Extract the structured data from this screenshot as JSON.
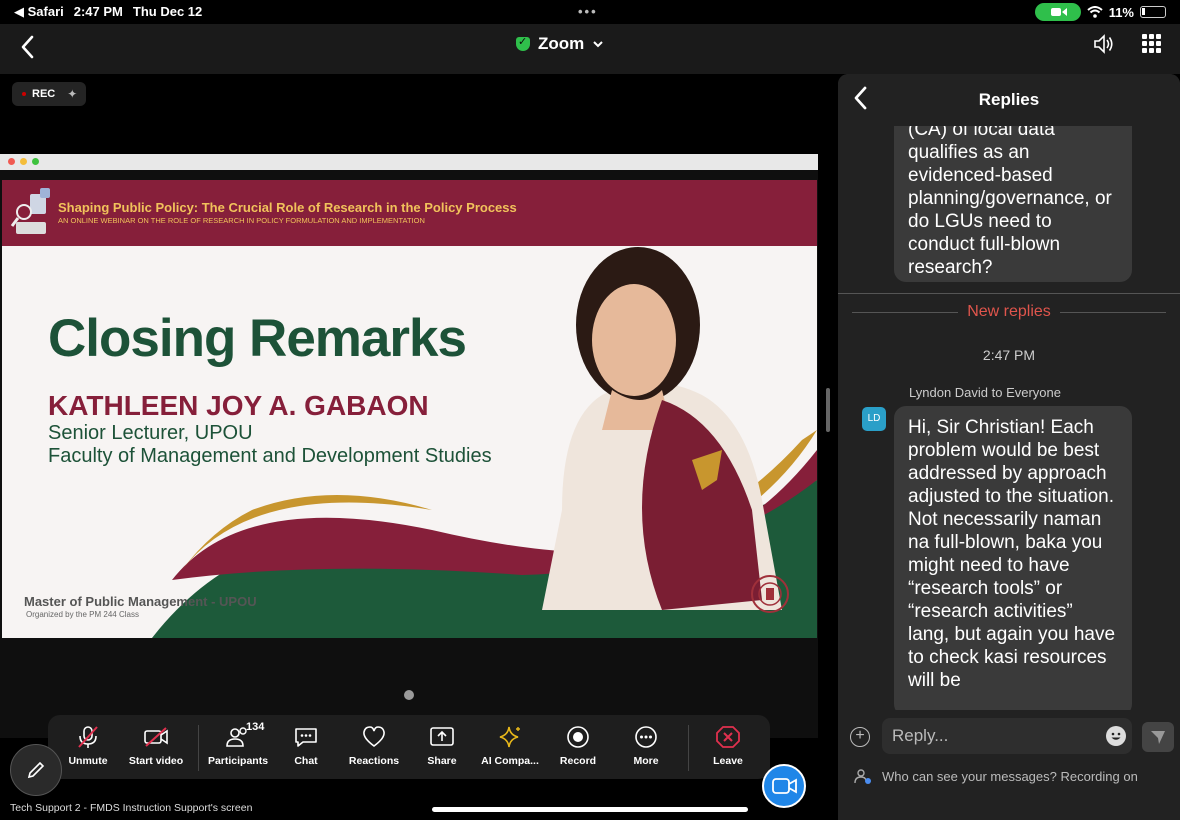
{
  "status_bar": {
    "back_app": "◀ Safari",
    "time": "2:47 PM",
    "date": "Thu Dec 12",
    "dots": "•••",
    "wifi": "wifi",
    "battery": "11%"
  },
  "header": {
    "title": "Zoom",
    "chevron": "⌄"
  },
  "meeting": {
    "rec_label": "REC",
    "slide": {
      "banner_title": "Shaping Public Policy: The Crucial Role of Research in the Policy Process",
      "banner_subtitle": "AN ONLINE WEBINAR ON THE ROLE OF RESEARCH IN POLICY FORMULATION AND IMPLEMENTATION",
      "heading": "Closing Remarks",
      "speaker": "KATHLEEN JOY A. GABAON",
      "role_line1": "Senior Lecturer, UPOU",
      "role_line2": "Faculty of Management and Development Studies",
      "footer_program": "Master of Public Management - UPOU",
      "footer_organizer": "Organized by the PM 244 Class"
    },
    "screen_label": "Tech Support 2 - FMDS Instruction Support's screen"
  },
  "toolbar": {
    "unmute": "Unmute",
    "start_video": "Start video",
    "participants": "Participants",
    "participants_count": "134",
    "chat": "Chat",
    "reactions": "Reactions",
    "share": "Share",
    "ai": "AI Compa...",
    "record": "Record",
    "more": "More",
    "leave": "Leave"
  },
  "replies": {
    "title": "Replies",
    "first_message": "(CA) of local data qualifies as an evidenced-based planning/governance, or do LGUs need to conduct full-blown research?",
    "new_replies_label": "New replies",
    "time": "2:47 PM",
    "sender": "Lyndon David to Everyone",
    "avatar_initials": "LD",
    "reply_message": "Hi, Sir Christian! Each problem would be best addressed by approach adjusted to the situation. Not necessarily naman na full-blown, baka you might need to have “research tools” or “research activities” lang, but again you have to check kasi resources will be",
    "reply_placeholder": "Reply...",
    "notice": "Who can see your messages? Recording on"
  },
  "colors": {
    "banner": "#861f3a",
    "banner_text": "#f1c25b",
    "heading_green": "#1d5238",
    "new_replies": "#e0554c",
    "leave_red": "#e0304e",
    "ai_gold": "#e8b81a"
  }
}
